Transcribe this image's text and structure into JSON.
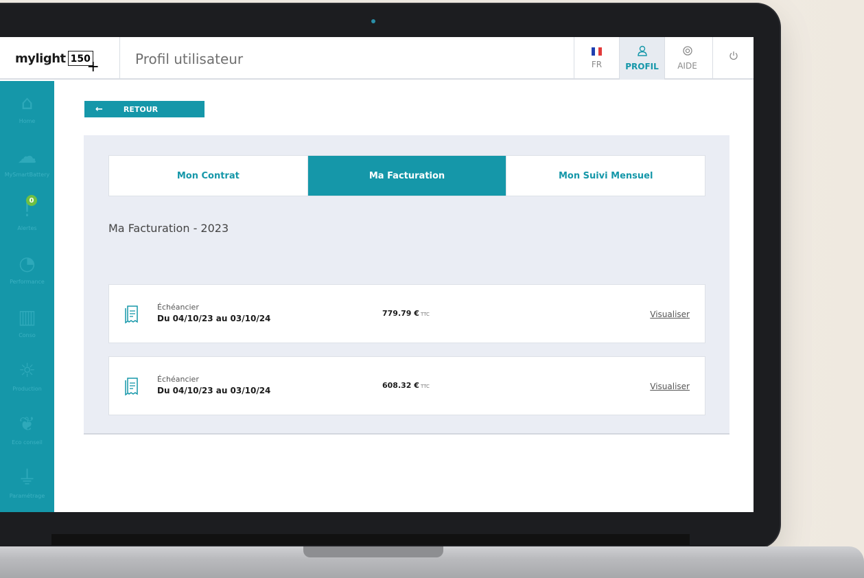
{
  "app": {
    "logo_text": "mylight",
    "logo_box": "150",
    "logo_plus": "+",
    "page_title": "Profil utilisateur"
  },
  "header": {
    "lang_label": "FR",
    "profil_label": "PROFIL",
    "aide_label": "AIDE",
    "flag_colors": [
      "#1f3fb0",
      "#ffffff",
      "#e23a3a"
    ]
  },
  "sidebar": {
    "items": [
      {
        "label": "Home",
        "icon": "home-icon",
        "glyph": "⌂"
      },
      {
        "label": "MySmartBattery",
        "icon": "battery-cloud-icon",
        "glyph": "☁"
      },
      {
        "label": "Alertes",
        "icon": "alert-icon",
        "glyph": "!",
        "badge": "0"
      },
      {
        "label": "Performance",
        "icon": "gauge-icon",
        "glyph": "◔"
      },
      {
        "label": "Conso",
        "icon": "bar-chart-icon",
        "glyph": "▥"
      },
      {
        "label": "Production",
        "icon": "solar-panel-icon",
        "glyph": "☼"
      },
      {
        "label": "Eco conseil",
        "icon": "leaf-icon",
        "glyph": "❦"
      },
      {
        "label": "Paramétrage",
        "icon": "plug-icon",
        "glyph": "⏚"
      }
    ]
  },
  "back": {
    "label": "RETOUR"
  },
  "tabs": [
    {
      "label": "Mon Contrat"
    },
    {
      "label": "Ma Facturation"
    },
    {
      "label": "Mon Suivi Mensuel"
    }
  ],
  "section_title": "Ma Facturation - 2023",
  "invoices": [
    {
      "type": "Échéancier",
      "period": "Du 04/10/23 au 03/10/24",
      "amount": "779.79 €",
      "tax": "TTC",
      "link": "Visualiser"
    },
    {
      "type": "Échéancier",
      "period": "Du 04/10/23 au 03/10/24",
      "amount": "608.32 €",
      "tax": "TTC",
      "link": "Visualiser"
    }
  ],
  "colors": {
    "accent": "#1597a9",
    "badge": "#6fbf43",
    "panel": "#eaedf4"
  }
}
